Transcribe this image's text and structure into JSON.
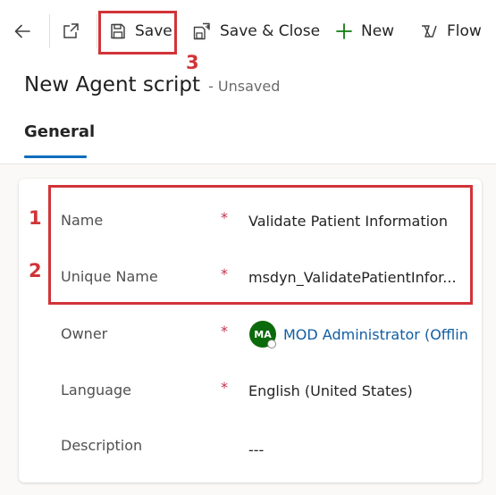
{
  "toolbar": {
    "back_icon": "back-arrow-icon",
    "popout_icon": "open-in-new-window-icon",
    "save_label": "Save",
    "save_close_label": "Save & Close",
    "new_label": "New",
    "flow_label": "Flow"
  },
  "page": {
    "title": "New Agent script",
    "status": "- Unsaved"
  },
  "tabs": [
    {
      "label": "General",
      "selected": true
    }
  ],
  "form": {
    "fields": [
      {
        "label": "Name",
        "required": "*",
        "value": "Validate Patient Information"
      },
      {
        "label": "Unique Name",
        "required": "*",
        "value": "msdyn_ValidatePatientInfor..."
      },
      {
        "label": "Owner",
        "required": "*",
        "value": "MOD Administrator (Offlin",
        "avatar_initials": "MA"
      },
      {
        "label": "Language",
        "required": "*",
        "value": "English (United States)"
      },
      {
        "label": "Description",
        "required": "",
        "value": "---"
      }
    ]
  },
  "annotations": {
    "n1": "1",
    "n2": "2",
    "n3": "3"
  },
  "colors": {
    "accent": "#0f6cbd",
    "annotation_red": "#d13438",
    "required_red": "#c4314b",
    "avatar_green": "#0b6a0b",
    "link_blue": "#115ea3"
  }
}
